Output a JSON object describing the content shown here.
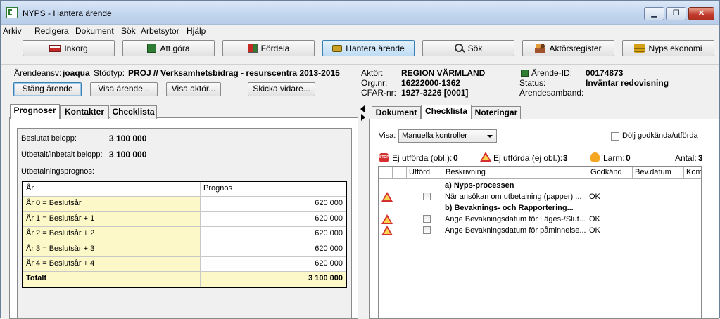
{
  "window": {
    "title": "NYPS - Hantera ärende",
    "min_label": "▁",
    "max_label": "❐",
    "close_label": "✕"
  },
  "menu": [
    "Arkiv",
    "Redigera",
    "Dokument",
    "Sök",
    "Arbetsytor",
    "Hjälp"
  ],
  "toolbar": {
    "inkorg": "Inkorg",
    "att_gora": "Att göra",
    "fordela": "Fördela",
    "hantera": "Hantera ärende",
    "sok": "Sök",
    "aktorsregister": "Aktörsregister",
    "ekonomi": "Nyps ekonomi"
  },
  "case": {
    "arendeansv_label": "Ärendeansv:",
    "arendeansv": "joaqua",
    "stodtyp_label": "Stödtyp:",
    "stodtyp": "PROJ // Verksamhetsbidrag - resurscentra 2013-2015",
    "aktor_label": "Aktör:",
    "aktor": "REGION VÄRMLAND",
    "orgnr_label": "Org.nr:",
    "orgnr": "16222000-1362",
    "cfar_label": "CFAR-nr:",
    "cfar": "1927-3226 [0001]",
    "arende_id_label": "Ärende-ID:",
    "arende_id": "00174873",
    "status_label": "Status:",
    "status": "Inväntar redovisning",
    "samband_label": "Ärendesamband:"
  },
  "actions": {
    "stang": "Stäng ärende",
    "visa_arende": "Visa ärende...",
    "visa_aktor": "Visa aktör...",
    "skicka": "Skicka vidare..."
  },
  "left_tabs": [
    "Prognoser",
    "Kontakter",
    "Checklista"
  ],
  "prognos": {
    "beslutat_label": "Beslutat belopp:",
    "beslutat": "3 100 000",
    "utbetalt_label": "Utbetalt/inbetalt belopp:",
    "utbetalt": "3 100 000",
    "utbet_prognos_label": "Utbetalningsprognos:",
    "headers": [
      "År",
      "Prognos"
    ],
    "rows": [
      [
        "År 0 = Beslutsår",
        "620 000"
      ],
      [
        "År 1 = Beslutsår + 1",
        "620 000"
      ],
      [
        "År 2 = Beslutsår + 2",
        "620 000"
      ],
      [
        "År 3 = Beslutsår + 3",
        "620 000"
      ],
      [
        "År 4 = Beslutsår + 4",
        "620 000"
      ]
    ],
    "total": [
      "Totalt",
      "3 100 000"
    ]
  },
  "right_tabs": [
    "Dokument",
    "Checklista",
    "Noteringar"
  ],
  "checklist": {
    "visa_label": "Visa:",
    "visa_value": "Manuella kontroller",
    "dolj_label": "Dölj godkända/utförda",
    "ej_obl_label": "Ej utförda (obl.):",
    "ej_obl": "0",
    "ej_ejobl_label": "Ej utförda (ej obl.):",
    "ej_ejobl": "3",
    "larm_label": "Larm:",
    "larm": "0",
    "antal_label": "Antal:",
    "antal": "3",
    "stop_icon_text": "STOP",
    "headers": [
      "",
      "Utförd",
      "Beskrivning",
      "Godkänd",
      "Bev.datum",
      "Kom"
    ],
    "rows": [
      {
        "text": "a) Nyps-processen",
        "bold": true
      },
      {
        "text": "När ansökan om utbetalning (papper) ...",
        "ok": "OK",
        "warn": true,
        "check": true
      },
      {
        "text": "b) Bevaknings- och Rapportering...",
        "bold": true
      },
      {
        "text": "Ange Bevakningsdatum för Läges-/Slut...",
        "ok": "OK",
        "warn": true,
        "check": true
      },
      {
        "text": "Ange Bevakningsdatum för påminnelse...",
        "ok": "OK",
        "warn": true,
        "check": true
      }
    ]
  }
}
